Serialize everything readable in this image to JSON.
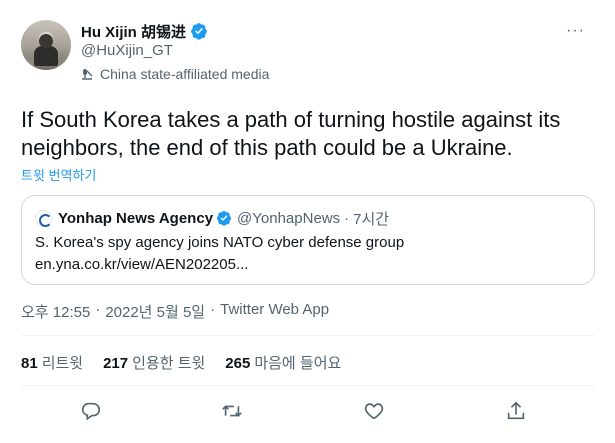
{
  "author": {
    "display_name": "Hu Xijin 胡锡进",
    "handle": "@HuXijin_GT",
    "affiliation": "China state-affiliated media"
  },
  "more_label": "···",
  "tweet": {
    "text": "If South Korea takes a path of turning hostile against its neighbors, the end of this path could be a Ukraine.",
    "translate_label": "트윗 번역하기"
  },
  "quote": {
    "display_name": "Yonhap News Agency",
    "handle": "@YonhapNews",
    "dot": "·",
    "time": "7시간",
    "line1": "S. Korea's spy agency joins NATO cyber defense group",
    "line2": "en.yna.co.kr/view/AEN202205..."
  },
  "meta": {
    "time": "오후 12:55",
    "sep": "·",
    "date": "2022년 5월 5일",
    "source": "Twitter Web App"
  },
  "stats": {
    "retweets": {
      "count": "81",
      "label": "리트윗"
    },
    "quotes": {
      "count": "217",
      "label": "인용한 트윗"
    },
    "likes": {
      "count": "265",
      "label": "마음에 들어요"
    }
  },
  "colors": {
    "accent": "#1d9bf0",
    "text": "#0f1419",
    "secondary": "#536471",
    "border": "#cfd9de"
  },
  "icons": {
    "verified": "verified-badge-icon",
    "affiliation": "microphone-stand-icon",
    "reply": "reply-icon",
    "retweet": "retweet-icon",
    "like": "heart-icon",
    "share": "share-icon"
  }
}
